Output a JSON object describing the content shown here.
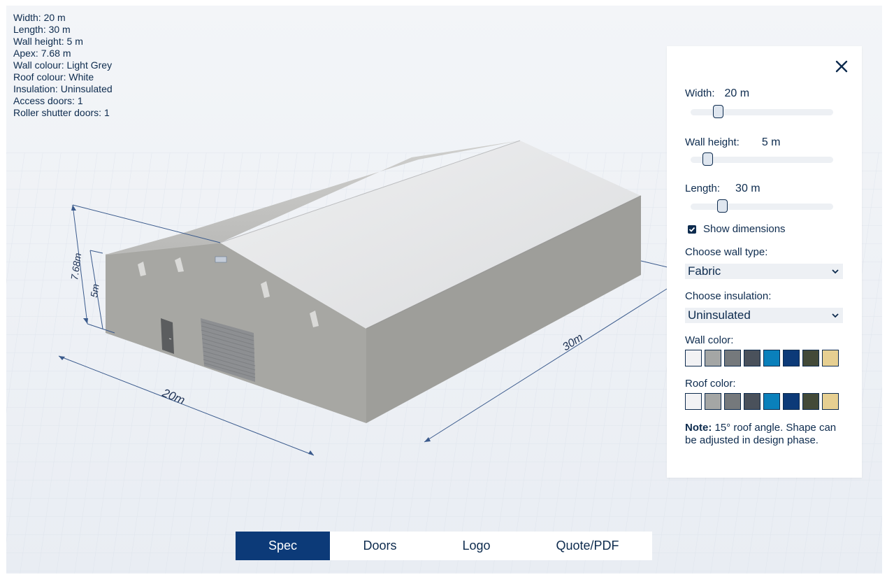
{
  "spec_summary": {
    "width": "Width: 20 m",
    "length": "Length: 30 m",
    "wall_height": "Wall height: 5 m",
    "apex": "Apex: 7.68 m",
    "wall_colour": "Wall colour: Light Grey",
    "roof_colour": "Roof colour: White",
    "insulation": "Insulation: Uninsulated",
    "access_doors": "Access doors: 1",
    "roller_shutter_doors": "Roller shutter doors: 1"
  },
  "dimensions": {
    "apex": "7.68m",
    "wall_height": "5m",
    "width": "20m",
    "length": "30m"
  },
  "panel": {
    "close_icon": "close-icon",
    "width": {
      "label": "Width:",
      "value": "20",
      "unit": "m",
      "level": 0.17
    },
    "wall_height": {
      "label": "Wall height:",
      "value": "5",
      "unit": "m",
      "level": 0.09
    },
    "length": {
      "label": "Length:",
      "value": "30",
      "unit": "m",
      "level": 0.2
    },
    "show_dimensions": {
      "label": "Show dimensions",
      "checked": true
    },
    "wall_type": {
      "label": "Choose wall type:",
      "value": "Fabric"
    },
    "insulation": {
      "label": "Choose insulation:",
      "value": "Uninsulated"
    },
    "wall_color": {
      "label": "Wall color:"
    },
    "roof_color": {
      "label": "Roof color:"
    },
    "swatch_colors": [
      "#f2f2f4",
      "#a4a6a5",
      "#75797c",
      "#4a515b",
      "#0a80bb",
      "#0c3a78",
      "#434a38",
      "#e6cf91"
    ],
    "note_bold": "Note:",
    "note_text": " 15° roof angle. Shape can be adjusted in design phase."
  },
  "tabs": [
    {
      "label": "Spec",
      "active": true
    },
    {
      "label": "Doors",
      "active": false
    },
    {
      "label": "Logo",
      "active": false
    },
    {
      "label": "Quote/PDF",
      "active": false
    }
  ],
  "colors": {
    "navy": "#0d2b4e",
    "accent": "#0c3a78",
    "wall": "#a9a9a5",
    "roof": "#e8e9ea"
  }
}
